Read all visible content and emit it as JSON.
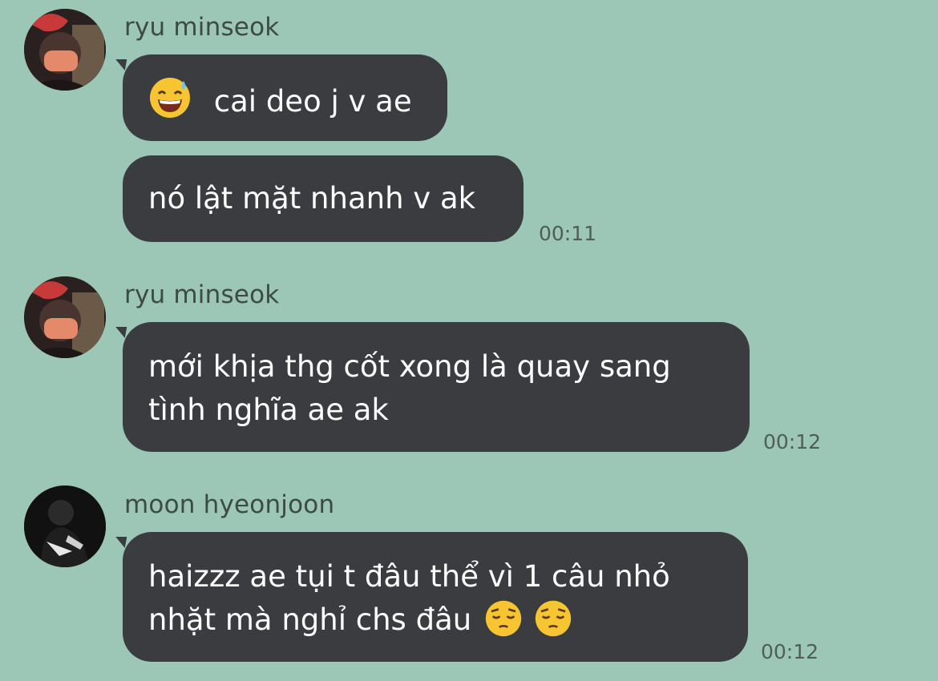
{
  "messages": [
    {
      "sender": "ryu minseok",
      "avatar_icon": "user-avatar-red-hair-mask",
      "bubbles": [
        {
          "emoji": "grinning-sweat-emoji",
          "text": "cai deo j v ae"
        },
        {
          "text": "nó lật mặt nhanh v ak"
        }
      ],
      "time": "00:11"
    },
    {
      "sender": "ryu minseok",
      "avatar_icon": "user-avatar-red-hair-mask",
      "bubbles": [
        {
          "lines": [
            "mới khịa thg cốt xong là quay sang",
            "tình nghĩa ae ak"
          ]
        }
      ],
      "time": "00:12"
    },
    {
      "sender": "moon hyeonjoon",
      "avatar_icon": "user-avatar-dark-figure",
      "bubbles": [
        {
          "lines": [
            "haizzz ae tụi t đâu thể vì 1 câu nhỏ",
            "nhặt mà nghỉ chs đâu"
          ],
          "trailing_emoji": [
            "pensive-face-emoji",
            "pensive-face-emoji"
          ]
        }
      ],
      "time": "00:12"
    }
  ],
  "colors": {
    "background": "#9cc6b5",
    "bubble": "#3b3c3f",
    "bubble_text": "#ffffff",
    "sender_text": "#3d4a45",
    "timestamp": "#4e5e58"
  }
}
